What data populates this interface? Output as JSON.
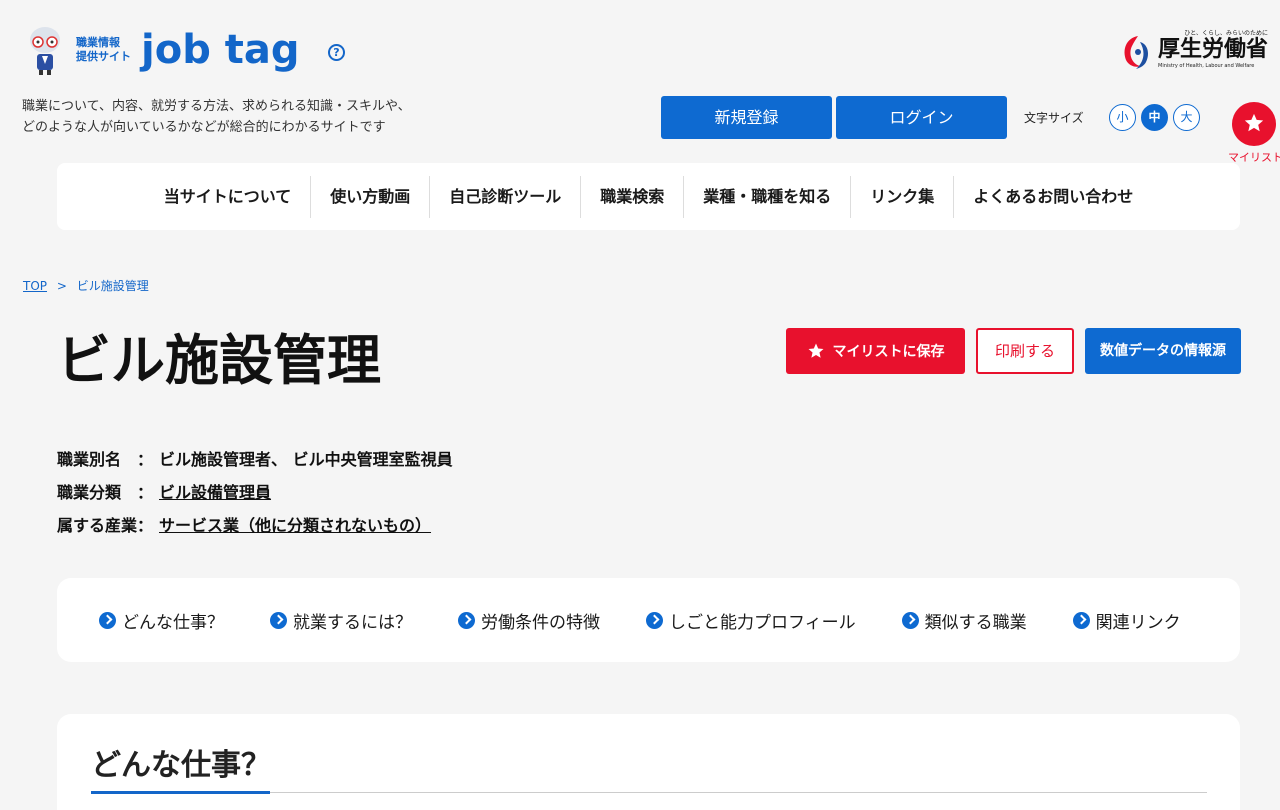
{
  "header": {
    "logo_sub_line1": "職業情報",
    "logo_sub_line2": "提供サイト",
    "logo_main": "job tag",
    "help_icon": "?",
    "tagline_line1": "職業について、内容、就労する方法、求められる知識・スキルや、",
    "tagline_line2": "どのような人が向いているかなどが総合的にわかるサイトです",
    "ministry_top": "ひと、くらし、みらいのために",
    "ministry_name": "厚生労働省",
    "ministry_en": "Ministry of Health, Labour and Welfare",
    "register_label": "新規登録",
    "login_label": "ログイン",
    "font_size_label": "文字サイズ",
    "font_small": "小",
    "font_medium": "中",
    "font_large": "大",
    "mylist_label": "マイリスト"
  },
  "nav": {
    "items": [
      "当サイトについて",
      "使い方動画",
      "自己診断ツール",
      "職業検索",
      "業種・職種を知る",
      "リンク集",
      "よくあるお問い合わせ"
    ]
  },
  "breadcrumb": {
    "top": "TOP",
    "separator": ">",
    "current": "ビル施設管理"
  },
  "page": {
    "title": "ビル施設管理",
    "save_label": "マイリストに保存",
    "print_label": "印刷する",
    "source_label": "数値データの情報源"
  },
  "meta": {
    "alias_label": "職業別名　：",
    "alias_value": "ビル施設管理者、 ビル中央管理室監視員",
    "category_label": "職業分類　：",
    "category_value": "ビル設備管理員",
    "industry_label": "属する産業：",
    "industry_value": "サービス業（他に分類されないもの）"
  },
  "anchors": [
    "どんな仕事？",
    "就業するには？",
    "労働条件の特徴",
    "しごと能力プロフィール",
    "類似する職業",
    "関連リンク"
  ],
  "section": {
    "title": "どんな仕事？"
  },
  "colors": {
    "brand_blue": "#0e6ad1",
    "accent_red": "#e8112d",
    "background": "#f5f5f5"
  }
}
